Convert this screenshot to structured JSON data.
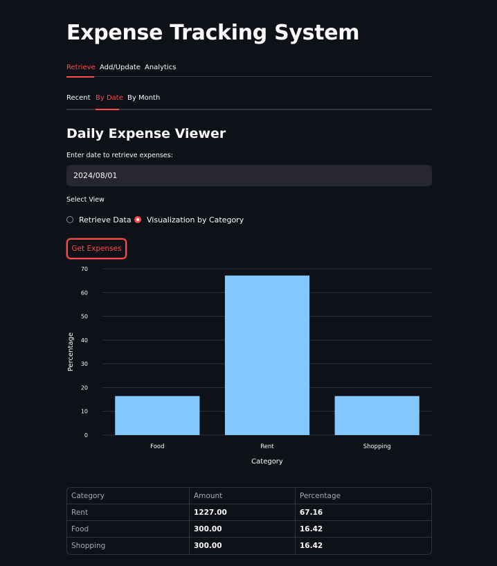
{
  "app": {
    "title": "Expense Tracking System"
  },
  "main_tabs": [
    {
      "label": "Retrieve",
      "active": true
    },
    {
      "label": "Add/Update",
      "active": false
    },
    {
      "label": "Analytics",
      "active": false
    }
  ],
  "sub_tabs": [
    {
      "label": "Recent",
      "active": false
    },
    {
      "label": "By Date",
      "active": true
    },
    {
      "label": "By Month",
      "active": false
    }
  ],
  "viewer": {
    "header": "Daily Expense Viewer",
    "date_label": "Enter date to retrieve expenses:",
    "date_value": "2024/08/01",
    "view_label": "Select View",
    "view_options": [
      {
        "label": "Retrieve Data",
        "selected": false
      },
      {
        "label": "Visualization by Category",
        "selected": true
      }
    ],
    "button_label": "Get Expenses"
  },
  "colors": {
    "accent": "#ff4b4b",
    "bar": "#83c9ff",
    "background": "#0e1117"
  },
  "chart_data": {
    "type": "bar",
    "categories": [
      "Food",
      "Rent",
      "Shopping"
    ],
    "values": [
      16.42,
      67.16,
      16.42
    ],
    "xlabel": "Category",
    "ylabel": "Percentage",
    "ylim": [
      0,
      70
    ],
    "yticks": [
      0,
      10,
      20,
      30,
      40,
      50,
      60,
      70
    ],
    "grid": true,
    "color": "#83c9ff"
  },
  "table": {
    "columns": [
      "Category",
      "Amount",
      "Percentage"
    ],
    "rows": [
      [
        "Rent",
        "1227.00",
        "67.16"
      ],
      [
        "Food",
        "300.00",
        "16.42"
      ],
      [
        "Shopping",
        "300.00",
        "16.42"
      ]
    ]
  }
}
